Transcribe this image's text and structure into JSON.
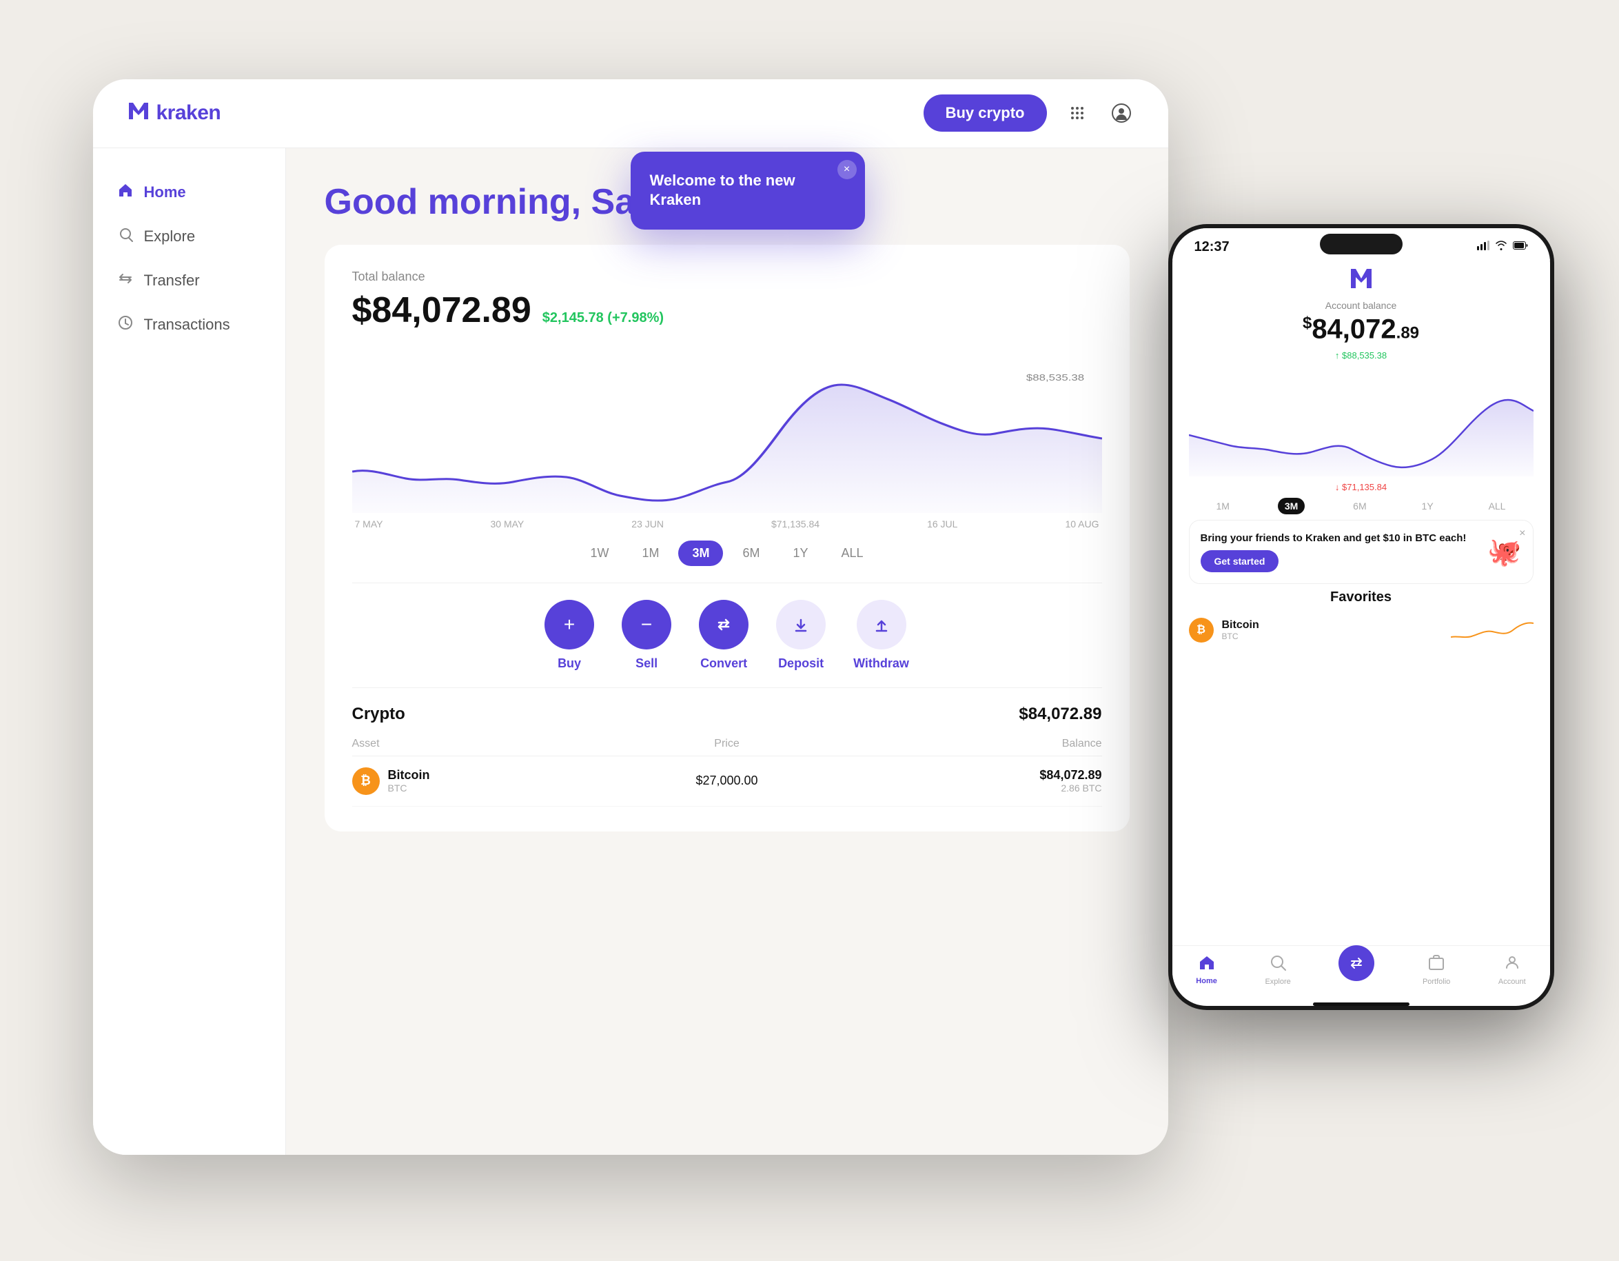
{
  "header": {
    "logo_text": "kraken",
    "buy_crypto_label": "Buy crypto",
    "grid_icon": "⊞",
    "user_icon": "👤"
  },
  "sidebar": {
    "items": [
      {
        "id": "home",
        "label": "Home",
        "icon": "🏠",
        "active": true
      },
      {
        "id": "explore",
        "label": "Explore",
        "icon": "🔍",
        "active": false
      },
      {
        "id": "transfer",
        "label": "Transfer",
        "icon": "↕",
        "active": false
      },
      {
        "id": "transactions",
        "label": "Transactions",
        "icon": "🕐",
        "active": false
      }
    ]
  },
  "main": {
    "greeting": "Good morning, Satoshi",
    "balance_label": "Total balance",
    "balance_amount": "$84,072.89",
    "balance_change": "$2,145.78 (+7.98%)",
    "chart": {
      "high_label": "$88,535.38",
      "low_label": "$71,135.84",
      "x_labels": [
        "7 MAY",
        "30 MAY",
        "23 JUN",
        "$71,135.84",
        "16 JUL",
        "10 AUG"
      ]
    },
    "time_filters": [
      "1W",
      "1M",
      "3M",
      "6M",
      "1Y",
      "ALL"
    ],
    "active_filter": "3M",
    "actions": [
      {
        "id": "buy",
        "label": "Buy",
        "icon": "+",
        "style": "dark"
      },
      {
        "id": "sell",
        "label": "Sell",
        "icon": "−",
        "style": "dark"
      },
      {
        "id": "convert",
        "label": "Convert",
        "icon": "⇄",
        "style": "dark"
      },
      {
        "id": "deposit",
        "label": "Deposit",
        "icon": "↓",
        "style": "light"
      },
      {
        "id": "withdraw",
        "label": "Withdraw",
        "icon": "↑",
        "style": "light"
      }
    ],
    "crypto_title": "Crypto",
    "crypto_total": "$84,072.89",
    "table_headers": {
      "asset": "Asset",
      "price": "Price",
      "balance": "Balance"
    },
    "rows": [
      {
        "name": "Bitcoin",
        "ticker": "BTC",
        "price": "$27,000.00",
        "balance_usd": "$84,072.89",
        "balance_crypto": "2.86 BTC"
      }
    ]
  },
  "notification": {
    "title": "Welcome to the new Kraken",
    "close_icon": "×"
  },
  "phone": {
    "status_time": "12:37",
    "logo_icon": "m",
    "balance_label": "Account balance",
    "balance_prefix": "$",
    "balance_main": "84,072",
    "balance_decimal": ".89",
    "chart_up_label": "↑ $88,535.38",
    "chart_down_label": "↓ $71,135.84",
    "time_filters": [
      "1M",
      "3M",
      "6M",
      "1Y",
      "ALL"
    ],
    "active_filter": "3M",
    "referral": {
      "title": "Bring your friends to Kraken and get $10 in BTC each!",
      "cta": "Get started"
    },
    "favorites_title": "Favorites",
    "favorites": [
      {
        "name": "Bitcoin",
        "ticker": "BTC"
      }
    ],
    "bottom_nav": [
      {
        "id": "home",
        "label": "Home",
        "icon": "⌂",
        "active": true
      },
      {
        "id": "explore",
        "label": "Explore",
        "icon": "◎",
        "active": false
      },
      {
        "id": "convert",
        "label": "",
        "icon": "⇄",
        "active": false,
        "is_fab": true
      },
      {
        "id": "portfolio",
        "label": "Portfolio",
        "icon": "⊡",
        "active": false
      },
      {
        "id": "account",
        "label": "Account",
        "icon": "👤",
        "active": false
      }
    ]
  }
}
